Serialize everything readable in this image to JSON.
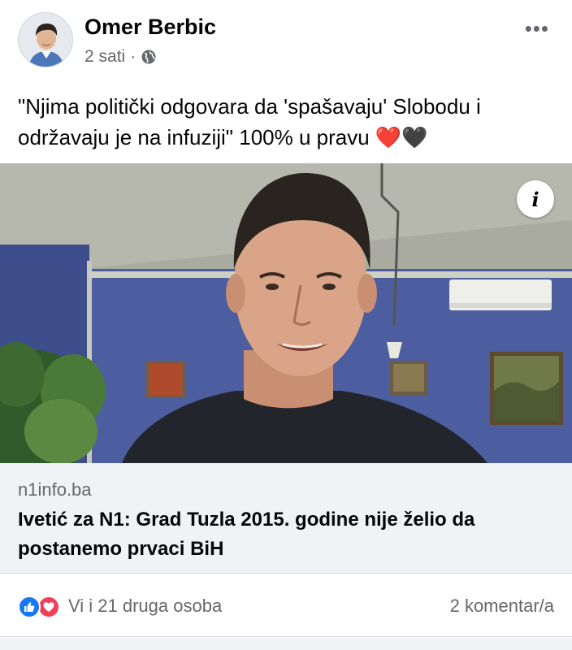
{
  "post": {
    "author": "Omer Berbic",
    "time": "2 sati",
    "separator": "·",
    "privacy_icon": "globe-icon",
    "more_label": "•••",
    "text": "\"Njima politički odgovara da 'spašavaju' Slobodu i održavaju je na infuziji\" 100% u pravu ❤️🖤"
  },
  "link": {
    "info_label": "i",
    "domain": "n1info.ba",
    "title": "Ivetić za N1: Grad Tuzla 2015. godine nije želio da postanemo prvaci BiH"
  },
  "reactions": {
    "icons": [
      "like-icon",
      "love-icon"
    ],
    "text": "Vi i 21 druga osoba",
    "comments": "2 komentar/a"
  },
  "colors": {
    "like": "#1877f2",
    "love": "#f33e58",
    "secondary_text": "#65676b"
  }
}
